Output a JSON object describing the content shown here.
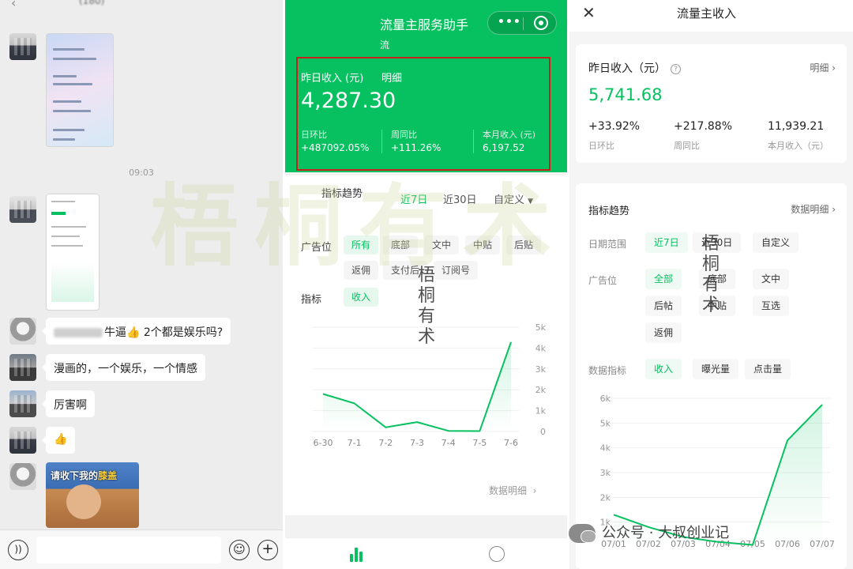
{
  "chat": {
    "title_blurred": "(180)",
    "time": "09:03",
    "messages": [
      {
        "text_suffix": "牛逼👍  2个都是娱乐吗?"
      },
      {
        "text": "漫画的，一个娱乐，一个情感"
      },
      {
        "text": "厉害啊"
      },
      {
        "text": "👍"
      }
    ],
    "meme_caption_pre": "请收下我的",
    "meme_caption_hl": "膝盖"
  },
  "mini": {
    "app_title": "流量主服务助手",
    "app_sub": "流",
    "yesterday_label": "昨日收入 (元)",
    "detail_label": "明细",
    "yesterday_value": "4,287.30",
    "stats": [
      {
        "label": "日环比",
        "value": "+487092.05%"
      },
      {
        "label": "周同比",
        "value": "+111.26%"
      },
      {
        "label": "本月收入 (元)",
        "value": "6,197.52"
      }
    ],
    "trend_label": "指标趋势",
    "ranges": [
      "近7日",
      "近30日",
      "自定义"
    ],
    "adpos_label": "广告位",
    "adpos": [
      "所有",
      "底部",
      "文中",
      "中贴",
      "后贴",
      "返佣",
      "支付后",
      "订阅号"
    ],
    "metric_label": "指标",
    "metric": "收入",
    "more_label": "数据明细"
  },
  "income": {
    "title": "流量主收入",
    "yesterday_label": "昨日收入（元）",
    "help": "?",
    "detail_label": "明细",
    "yesterday_value": "5,741.68",
    "stats": [
      {
        "value": "+33.92%",
        "label": "日环比"
      },
      {
        "value": "+217.88%",
        "label": "周同比"
      },
      {
        "value": "11,939.21",
        "label": "本月收入（元）"
      }
    ],
    "trend_label": "指标趋势",
    "more_label": "数据明细",
    "date_label": "日期范围",
    "dates": [
      "近7日",
      "近30日",
      "自定义"
    ],
    "adpos_label": "广告位",
    "adpos": [
      "全部",
      "底部",
      "文中",
      "后帖",
      "中贴",
      "互选",
      "返佣"
    ],
    "metric_label": "数据指标",
    "metrics": [
      "收入",
      "曝光量",
      "点击量"
    ]
  },
  "watermark": {
    "big": "梧桐有术",
    "callig": "梧桐有术",
    "footer": "公众号 · 大叔创业记"
  },
  "chart_data": [
    {
      "type": "line",
      "x": [
        "6-30",
        "7-1",
        "7-2",
        "7-3",
        "7-4",
        "7-5",
        "7-6"
      ],
      "series": [
        {
          "values": [
            1800,
            1350,
            200,
            450,
            30,
            20,
            4287.3
          ]
        }
      ],
      "yticks": [
        "0",
        "1k",
        "2k",
        "3k",
        "4k",
        "5k"
      ],
      "ylim": [
        0,
        5000
      ],
      "color": "#07c160"
    },
    {
      "type": "line",
      "x": [
        "07/01",
        "07/02",
        "07/03",
        "07/04",
        "07/05",
        "07/06",
        "07/07"
      ],
      "series": [
        {
          "values": [
            1300,
            800,
            400,
            200,
            80,
            4300,
            5741.68
          ]
        }
      ],
      "yticks": [
        "1k",
        "2k",
        "3k",
        "4k",
        "5k",
        "6k"
      ],
      "ylim": [
        0,
        6000
      ],
      "color": "#07c160"
    }
  ]
}
